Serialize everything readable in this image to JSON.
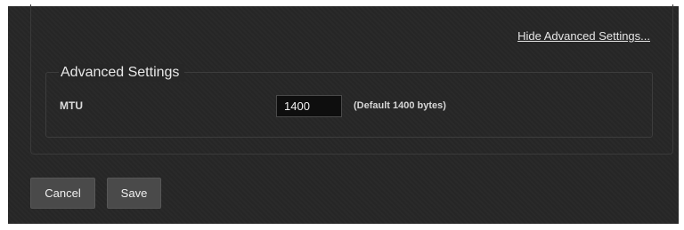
{
  "section": {
    "hide_link": "Hide Advanced Settings..."
  },
  "advanced": {
    "title": "Advanced Settings",
    "mtu": {
      "label": "MTU",
      "value": "1400",
      "hint": "(Default 1400 bytes)"
    }
  },
  "buttons": {
    "cancel": "Cancel",
    "save": "Save"
  },
  "colors": {
    "background": "#272727",
    "input_background": "#0e0e0e",
    "button_background": "#4a4a4a",
    "text": "#e6e6e6"
  }
}
